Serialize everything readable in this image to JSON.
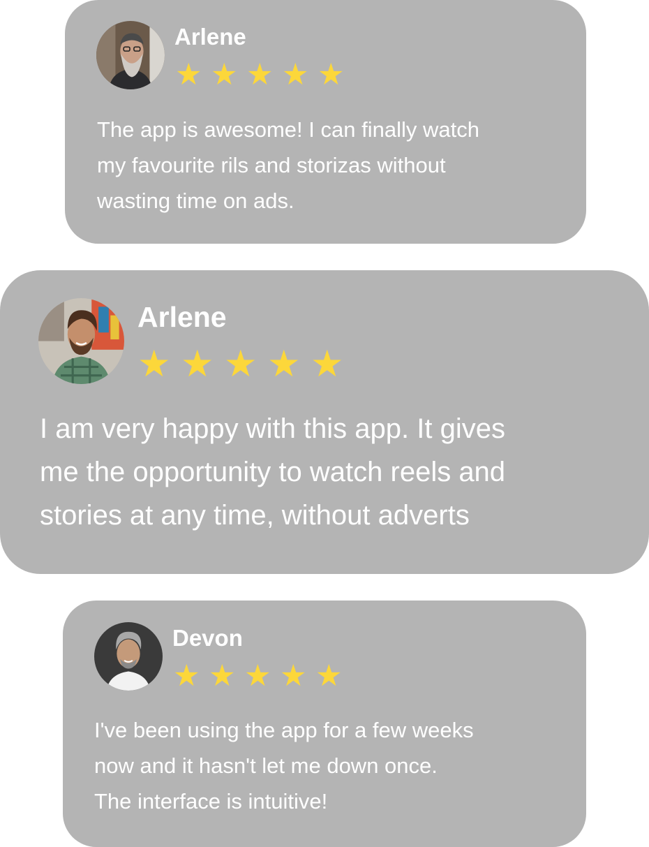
{
  "colors": {
    "card_background": "#b4b4b4",
    "text": "#ffffff",
    "star": "#fcd73a"
  },
  "reviews": [
    {
      "name": "Arlene",
      "rating": 5,
      "star_glyph": "★",
      "avatar_icon": "avatar-bearded-man-icon",
      "text_lines": [
        "The app is awesome! I can finally watch",
        "my favourite rils and storizas without",
        "wasting time on ads."
      ]
    },
    {
      "name": "Arlene",
      "rating": 5,
      "star_glyph": "★",
      "avatar_icon": "avatar-smiling-man-icon",
      "text_lines": [
        "I am very happy with this app. It gives",
        "me the opportunity to watch reels and",
        "stories at any time, without adverts"
      ]
    },
    {
      "name": "Devon",
      "rating": 5,
      "star_glyph": "★",
      "avatar_icon": "avatar-grey-haired-man-icon",
      "text_lines": [
        "I've been using the app for a few weeks",
        "now and it hasn't let me down once.",
        "The interface is intuitive!"
      ]
    }
  ]
}
